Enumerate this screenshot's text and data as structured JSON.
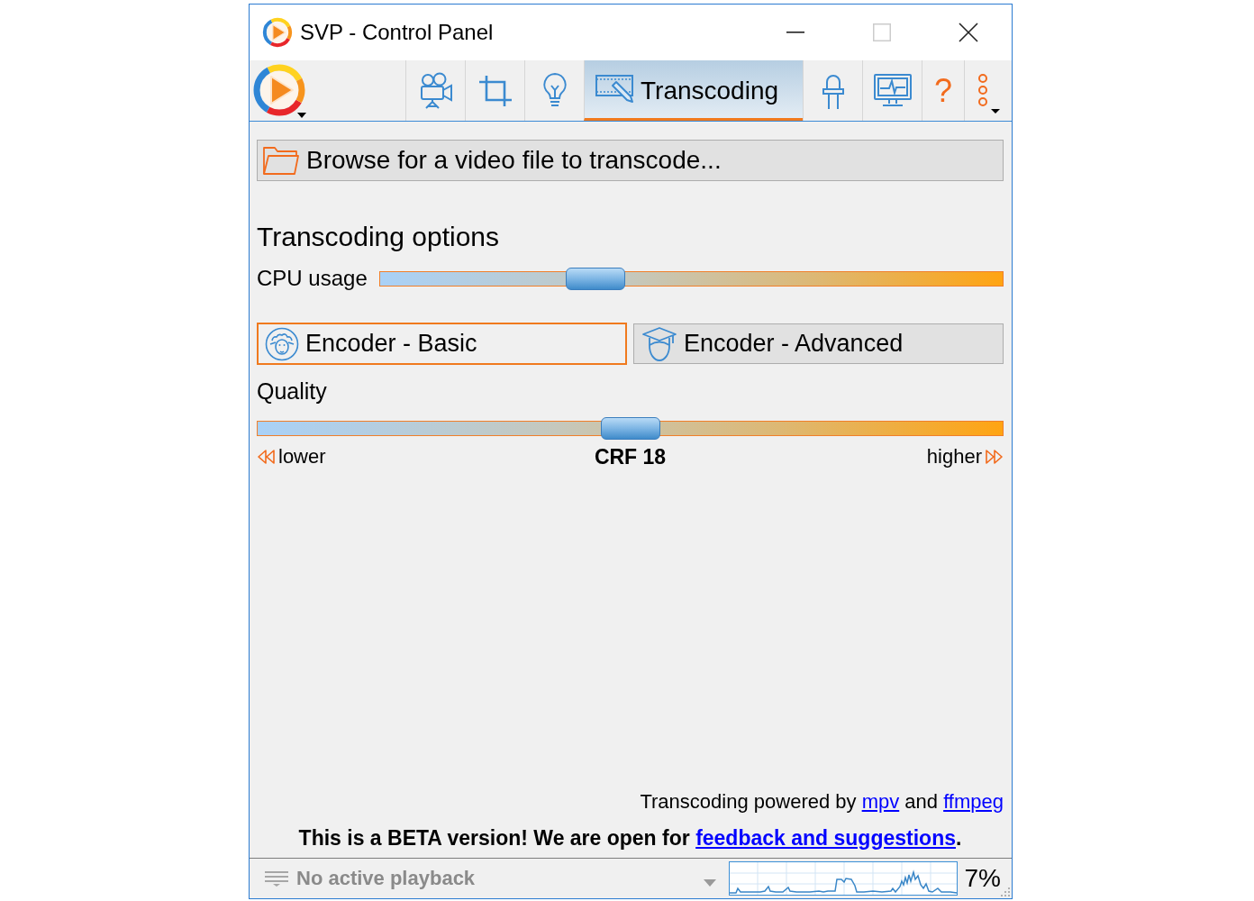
{
  "window": {
    "title": "SVP - Control Panel",
    "buttons": [
      {
        "kind": "minimize",
        "disabled": false
      },
      {
        "kind": "maximize",
        "disabled": true
      },
      {
        "kind": "close",
        "disabled": false
      }
    ]
  },
  "toolbar": {
    "tabs": [
      {
        "selected": false
      },
      {
        "selected": false
      },
      {
        "selected": false
      },
      {
        "label": "Transcoding",
        "selected": true
      },
      {
        "selected": false
      },
      {
        "selected": false
      }
    ],
    "help": "?"
  },
  "browse_button": {
    "label": "Browse for a video file to transcode..."
  },
  "options": {
    "heading": "Transcoding options",
    "cpu": {
      "label": "CPU usage",
      "level": 0.33
    },
    "encoders": [
      {
        "label": "Encoder - Basic",
        "selected": true
      },
      {
        "label": "Encoder - Advanced",
        "selected": false
      }
    ],
    "quality": {
      "label": "Quality",
      "level": 0.5,
      "lower": "lower",
      "value": "CRF 18",
      "higher": "higher"
    }
  },
  "credits": [
    {
      "kind": "text",
      "text": "Transcoding powered by "
    },
    {
      "kind": "link",
      "text": "mpv"
    },
    {
      "kind": "text",
      "text": " and "
    },
    {
      "kind": "link",
      "text": "ffmpeg"
    }
  ],
  "beta_notice": [
    {
      "kind": "text",
      "text": "This is a BETA version! We are open for "
    },
    {
      "kind": "link",
      "text": "feedback and suggestions"
    },
    {
      "kind": "text",
      "text": "."
    }
  ],
  "status_bar": {
    "playback": {
      "label": "No active playback",
      "disabled": true
    },
    "cpu_reading": "7%"
  }
}
